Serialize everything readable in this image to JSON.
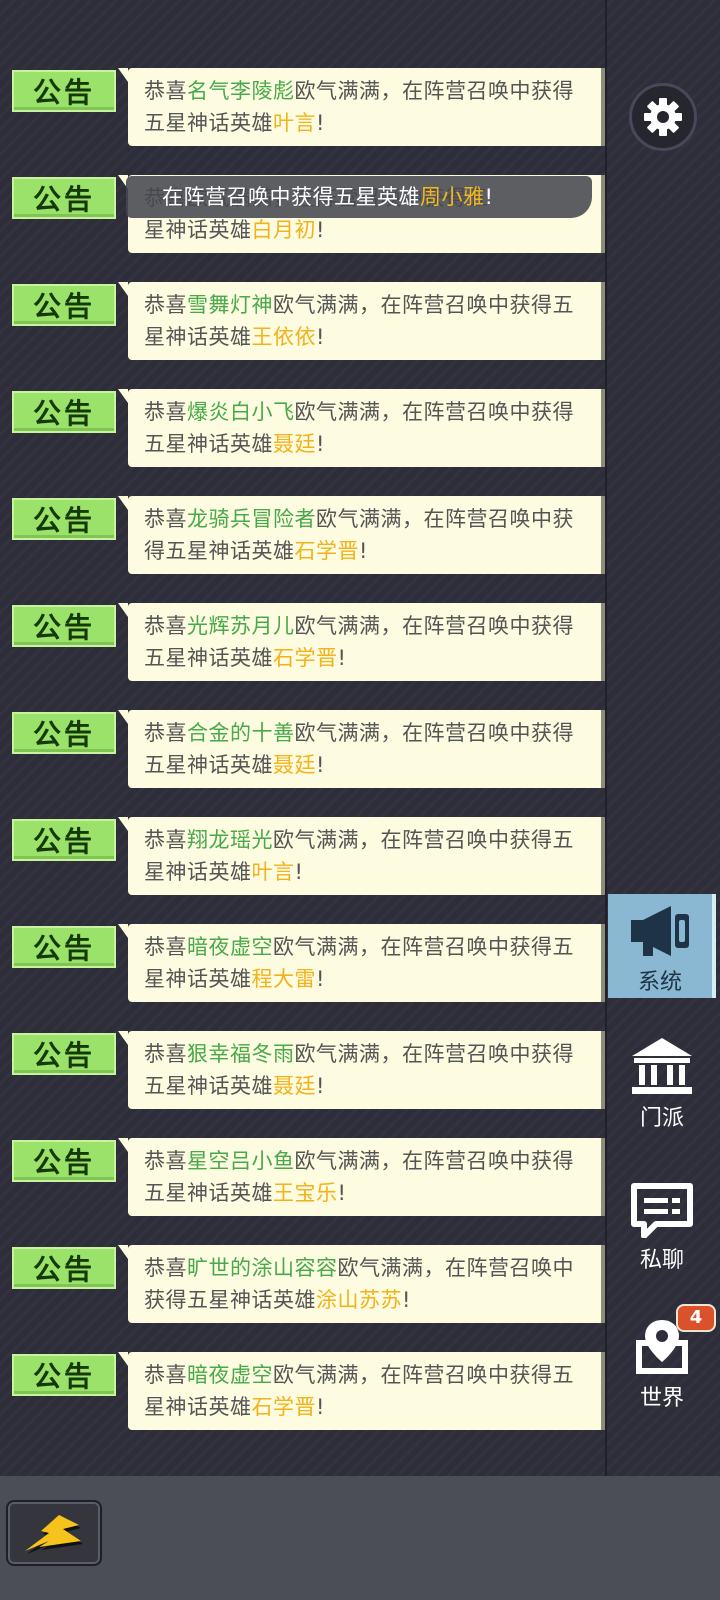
{
  "tag_label": "公告",
  "messages": [
    {
      "pre": "恭喜",
      "player": "名气李陵彪",
      "mid": "欧气满满，在阵营召唤中获得",
      "line2": "五星神话英雄",
      "hero": "叶言",
      "end": "!"
    },
    {
      "pre": "恭喜",
      "player": "",
      "mid": "欧气满满，在阵营召唤中获得五",
      "line2": "星神话英雄",
      "hero": "白月初",
      "end": "!"
    },
    {
      "pre": "恭喜",
      "player": "雪舞灯神",
      "mid": "欧气满满，在阵营召唤中获得五",
      "line2": "星神话英雄",
      "hero": "王依依",
      "end": "!"
    },
    {
      "pre": "恭喜",
      "player": "爆炎白小飞",
      "mid": "欧气满满，在阵营召唤中获得",
      "line2": "五星神话英雄",
      "hero": "聂廷",
      "end": "!"
    },
    {
      "pre": "恭喜",
      "player": "龙骑兵冒险者",
      "mid": "欧气满满，在阵营召唤中获",
      "line2": "得五星神话英雄",
      "hero": "石学晋",
      "end": "!"
    },
    {
      "pre": "恭喜",
      "player": "光辉苏月儿",
      "mid": "欧气满满，在阵营召唤中获得",
      "line2": "五星神话英雄",
      "hero": "石学晋",
      "end": "!"
    },
    {
      "pre": "恭喜",
      "player": "合金的十善",
      "mid": "欧气满满，在阵营召唤中获得",
      "line2": "五星神话英雄",
      "hero": "聂廷",
      "end": "!"
    },
    {
      "pre": "恭喜",
      "player": "翔龙瑶光",
      "mid": "欧气满满，在阵营召唤中获得五",
      "line2": "星神话英雄",
      "hero": "叶言",
      "end": "!"
    },
    {
      "pre": "恭喜",
      "player": "暗夜虚空",
      "mid": "欧气满满，在阵营召唤中获得五",
      "line2": "星神话英雄",
      "hero": "程大雷",
      "end": "!"
    },
    {
      "pre": "恭喜",
      "player": "狠幸福冬雨",
      "mid": "欧气满满，在阵营召唤中获得",
      "line2": "五星神话英雄",
      "hero": "聂廷",
      "end": "!"
    },
    {
      "pre": "恭喜",
      "player": "星空吕小鱼",
      "mid": "欧气满满，在阵营召唤中获得",
      "line2": "五星神话英雄",
      "hero": "王宝乐",
      "end": "!"
    },
    {
      "pre": "恭喜",
      "player": "旷世的涂山容容",
      "mid": "欧气满满，在阵营召唤中",
      "line2": "获得五星神话英雄",
      "hero": "涂山苏苏",
      "end": "!"
    },
    {
      "pre": "恭喜",
      "player": "暗夜虚空",
      "mid": "欧气满满，在阵营召唤中获得五",
      "line2": "星神话英雄",
      "hero": "石学晋",
      "end": "!"
    }
  ],
  "toast": {
    "text": "在阵营召唤中获得五星英雄",
    "hero": "周小雅",
    "end": "!"
  },
  "sidebar": {
    "settings_icon": "gear-icon",
    "tabs": [
      {
        "label": "系统",
        "icon": "megaphone-icon",
        "active": true
      },
      {
        "label": "门派",
        "icon": "bank-icon",
        "active": false
      },
      {
        "label": "私聊",
        "icon": "chat-icon",
        "active": false
      },
      {
        "label": "世界",
        "icon": "map-pin-icon",
        "active": false,
        "badge": "4"
      }
    ]
  },
  "bottom": {
    "quick_icon": "lightning-icon"
  },
  "colors": {
    "player": "#48a94a",
    "hero": "#f2b21b",
    "tag_bg": "#9be26a",
    "bubble_bg": "#fdfbe0",
    "active_tab": "#8ab8d2",
    "badge": "#d9522c"
  }
}
